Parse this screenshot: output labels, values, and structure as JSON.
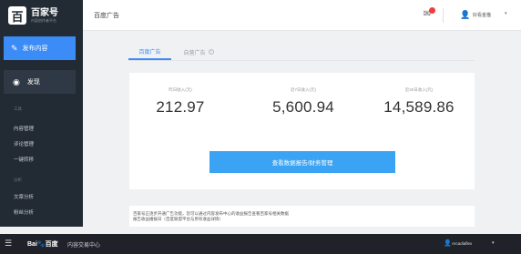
{
  "sidebar": {
    "logo_mark": "百",
    "logo_title": "百家号",
    "logo_sub": "内容创作者平台",
    "publish_label": "发布内容",
    "publish_icon": "pencil-icon",
    "discover_label": "发现",
    "discover_icon": "eye-icon",
    "group_tools": "工具",
    "items_tools": [
      "内容管理",
      "评论管理",
      "一键转移"
    ],
    "group_analysis": "分析",
    "items_analysis": [
      "文章分析",
      "粉丝分析"
    ]
  },
  "header": {
    "title": "百度广告",
    "mail_icon": "mail-icon",
    "user_icon": "user-icon",
    "user_name": "好看金猫",
    "caret": "▾"
  },
  "tabs": {
    "baidu_ads": "百度广告",
    "self_ads": "自营广告",
    "help": "?"
  },
  "stats": [
    {
      "label": "昨日收入(元)",
      "value": "212.97"
    },
    {
      "label": "近7日收入(元)",
      "value": "5,600.94"
    },
    {
      "label": "近30日收入(元)",
      "value": "14,589.86"
    }
  ],
  "report_button": "查看数据报告/财务管理",
  "notice": {
    "line1": "百家号正逐步开通广告功能，您可以通过内容发布中心的收益报告查看百家号相关数据",
    "line2": "报告收益播报日（百度联盟平台与原有收益详情）"
  },
  "taskbar": {
    "menu_icon": "menu-icon",
    "brand_prefix": "Bai",
    "brand_paw": "🐾",
    "brand_suffix": "百度",
    "subtitle": "内容交易中心",
    "user_name": "Arcadiaflex",
    "caret": "▾"
  },
  "colors": {
    "sidebar_bg": "#222a33",
    "accent": "#3b8cf6",
    "report_button": "#3aa3f4",
    "badge": "#f23b3b",
    "taskbar_bg": "#1f2329"
  }
}
